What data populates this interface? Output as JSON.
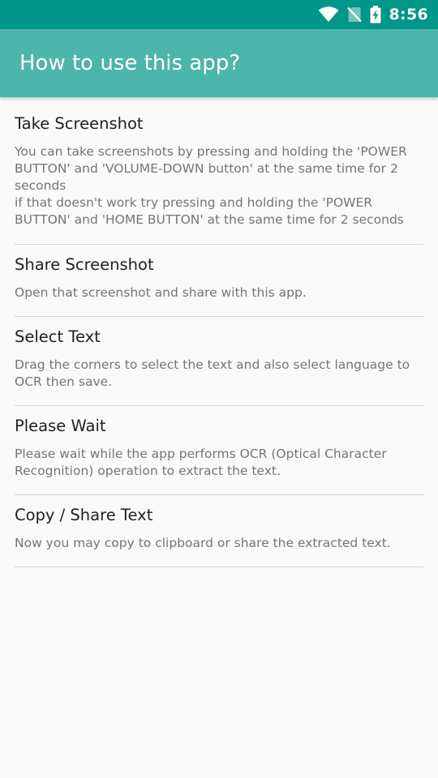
{
  "status_bar": {
    "time": "8:56",
    "icons": [
      "wifi-icon",
      "no-sim-icon",
      "battery-charging-icon"
    ]
  },
  "app_bar": {
    "title": "How to use this app?"
  },
  "sections": [
    {
      "title": "Take Screenshot",
      "body": "You can take screenshots by pressing and holding the 'POWER BUTTON' and 'VOLUME-DOWN button' at the same time for 2 seconds\n if that doesn't work try pressing and holding the 'POWER BUTTON' and 'HOME BUTTON' at the same time for 2 seconds"
    },
    {
      "title": "Share Screenshot",
      "body": "Open that screenshot and share with this app."
    },
    {
      "title": "Select Text",
      "body": "Drag the corners to select the text and also select language to OCR then save."
    },
    {
      "title": "Please Wait",
      "body": "Please wait while the app performs  OCR (Optical Character Recognition) operation to extract the text."
    },
    {
      "title": "Copy / Share Text",
      "body": "Now you may copy to clipboard or share the extracted text."
    }
  ],
  "colors": {
    "status_bar": "#009688",
    "app_bar": "#4db6ac",
    "background": "#fafafa",
    "title_text": "#212121",
    "body_text": "#757575",
    "divider": "#d6d6d6"
  }
}
